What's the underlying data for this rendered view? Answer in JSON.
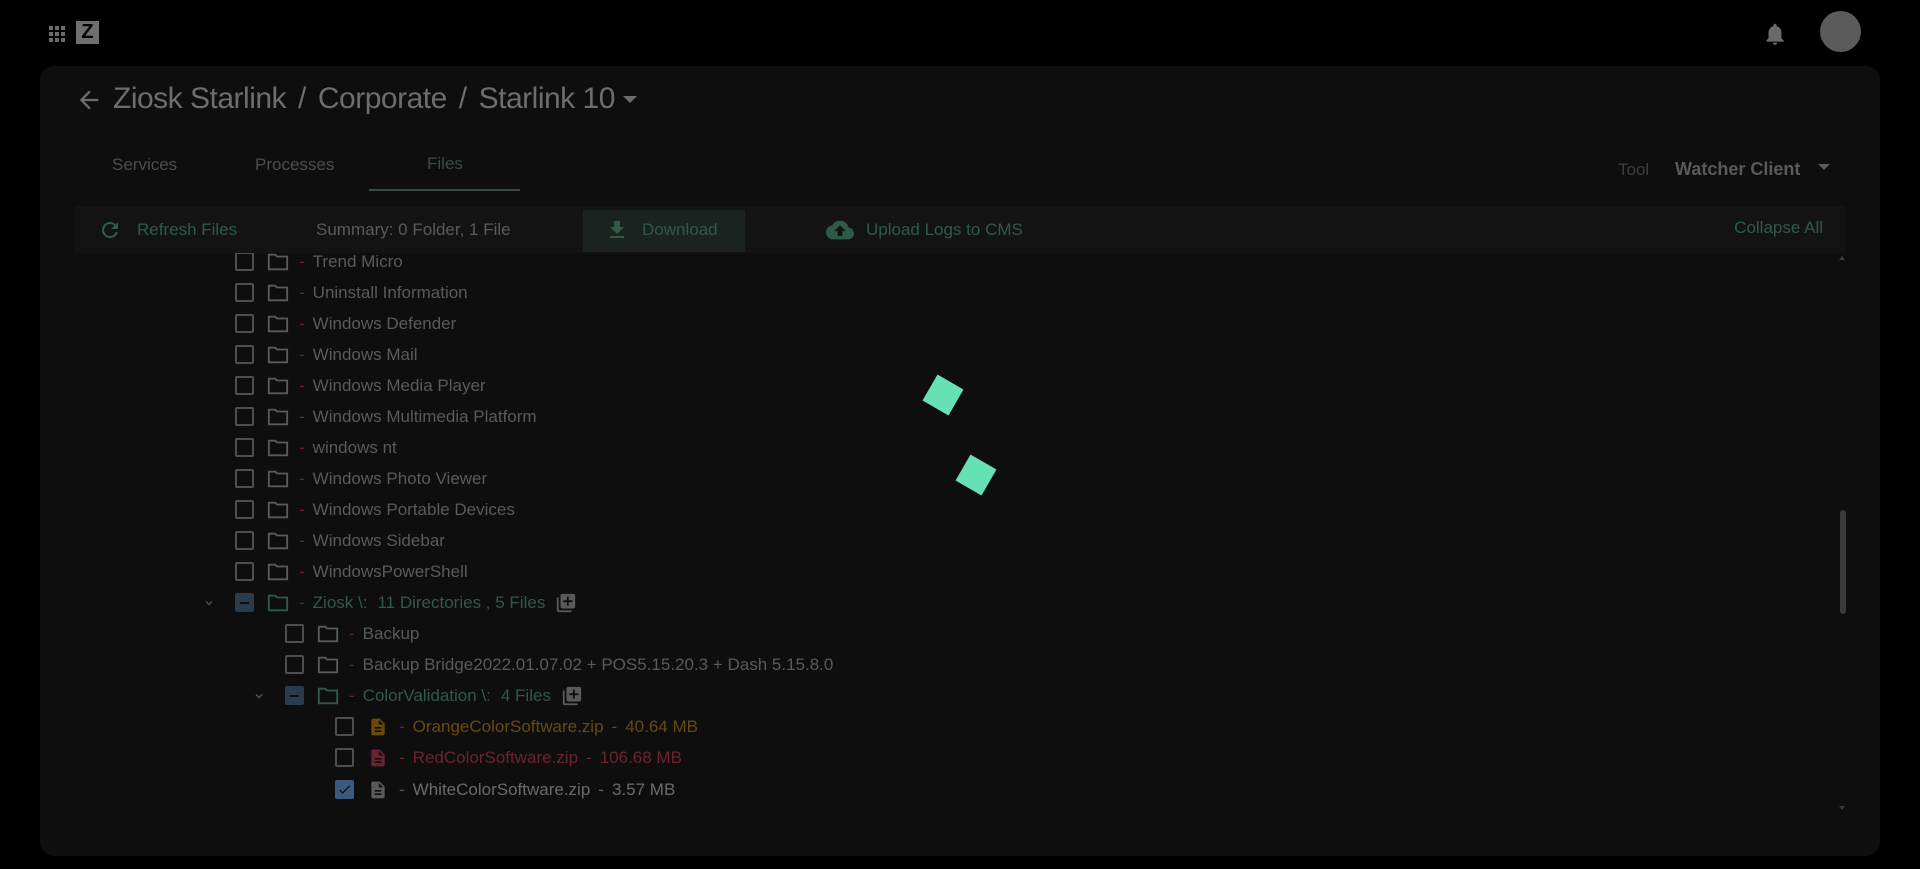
{
  "header": {
    "logo_letter": "Z",
    "icons": [
      "apps-grid-icon",
      "bell-icon",
      "avatar"
    ]
  },
  "breadcrumb": {
    "parts": [
      "Ziosk Starlink",
      "Corporate",
      "Starlink 10"
    ],
    "separator": "/"
  },
  "tabs": [
    {
      "label": "Services",
      "active": false
    },
    {
      "label": "Processes",
      "active": false
    },
    {
      "label": "Files",
      "active": true
    }
  ],
  "tool": {
    "label": "Tool",
    "value": "Watcher Client"
  },
  "toolbar": {
    "refresh_label": "Refresh Files",
    "summary": "Summary: 0 Folder, 1 File",
    "download_label": "Download",
    "upload_label": "Upload Logs to CMS",
    "collapse_label": "Collapse All"
  },
  "tree": {
    "root_folders": [
      "Trend Micro",
      "Uninstall Information",
      "Windows Defender",
      "Windows Mail",
      "Windows Media Player",
      "Windows Multimedia Platform",
      "windows nt",
      "Windows Photo Viewer",
      "Windows Portable Devices",
      "Windows Sidebar",
      "WindowsPowerShell"
    ],
    "ziosk": {
      "name": "Ziosk \\:",
      "summary": "11 Directories , 5 Files"
    },
    "ziosk_children": [
      "Backup",
      "Backup Bridge2022.01.07.02 + POS5.15.20.3 + Dash 5.15.8.0"
    ],
    "colorvalidation": {
      "name": "ColorValidation \\:",
      "summary": "4 Files"
    },
    "files": [
      {
        "name": "OrangeColorSoftware.zip",
        "size": "40.64 MB",
        "checked": false
      },
      {
        "name": "RedColorSoftware.zip",
        "size": "106.68 MB",
        "checked": false
      },
      {
        "name": "WhiteColorSoftware.zip",
        "size": "3.57 MB",
        "checked": true
      }
    ],
    "dash": "-"
  },
  "colors": {
    "accent_green": "#66e0b5",
    "orange_file": "#e8a21c",
    "red_file": "#e04a5f",
    "checkbox_blue": "#5b8ec6"
  }
}
